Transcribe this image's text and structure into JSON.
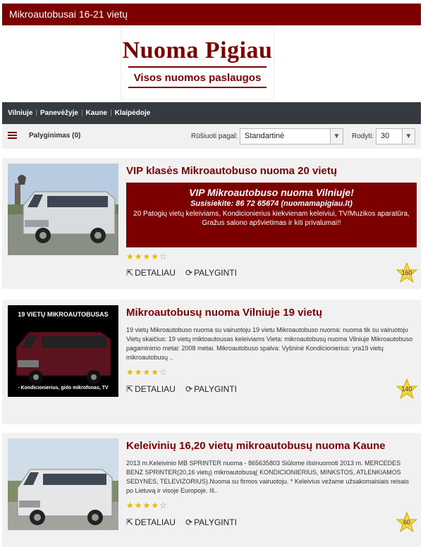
{
  "page": {
    "title": "Mikroautobusai 16-21 vietų"
  },
  "logo": {
    "brand": "Nuoma Pigiau",
    "tagline": "Visos nuomos paslaugos"
  },
  "nav": {
    "items": [
      "Vilniuje",
      "Panevėžyje",
      "Kaune",
      "Klaipėdoje"
    ]
  },
  "toolbar": {
    "compare_label": "Palyginimas (0)",
    "sort_label": "Rūšiuoti pagal:",
    "sort_value": "Standartinė",
    "show_label": "Rodyti:",
    "show_value": "30"
  },
  "cards": [
    {
      "title": "VIP klasės Mikroautobuso nuoma 20 vietų",
      "promo": {
        "line1": "VIP Mikroautobuso nuoma Vilniuje!",
        "line2": "Susisiekite: 86 72 65674 (nuomamapigiau.lt)",
        "line3": "20 Patogių vietų keleiviams, Kondicionierius kiekvienam keleiviui, TV/Muzikos aparatūra, Gražus salono apšvietimas ir kiti privalumai!!"
      },
      "stars_filled": 4,
      "stars_total": 5,
      "detail_label": "DETALIAU",
      "compare_label": "PALYGINTI",
      "badge": "160"
    },
    {
      "title": "Mikroautobusų nuoma Vilniuje 19 vietų",
      "image_caption_top": "19 VIETŲ MIKROAUTOBUSAS",
      "image_caption_bottom": "- Kondicionierius, gido mikrofonas, TV",
      "description": "19 vietų Mikroautobuso nuoma su vairuotoju 19 vietu Mikroautobuso nuoma: nuoma tik su vairuotoju Vietų skaičius: 19 vietų miktoautousas keleiviams Vieta: mikroautobusų nuoma Vilniuje Mikroautobuso pagaminimo metai: 2008 metai. Mikroautobuso spalva: Vyšninė Kondicionierius: yra19 vietų mikroautobusų ..",
      "stars_filled": 4,
      "stars_total": 5,
      "detail_label": "DETALIAU",
      "compare_label": "PALYGINTI",
      "badge": "140"
    },
    {
      "title": "Keleivinių 16,20 vietų mikroautobusų nuoma Kaune",
      "description": "2013 m.Keleivinio MB SPRINTER nuoma - 865635803 Siūlome išsinuomoti 2013 m. MERCEDES BENZ SPRINTER(20,16 vietų) mikroautobusą( KONDICIONIERIUS, MINKSTOS, ATLENKIAMOS SEDYNES, TELEVIZORIUS).Nuoma su firmos vairuotoju. * Keleivius vežame užsakomaisiais reisais po Lietuvą ir visoje Europoje. Iš..",
      "stars_filled": 4,
      "stars_total": 5,
      "detail_label": "DETALIAU",
      "compare_label": "PALYGINTI",
      "badge": "60"
    }
  ],
  "colors": {
    "brand": "#7d0000",
    "nav": "#343a40",
    "star": "#e8b800",
    "badge": "#f5d547"
  }
}
